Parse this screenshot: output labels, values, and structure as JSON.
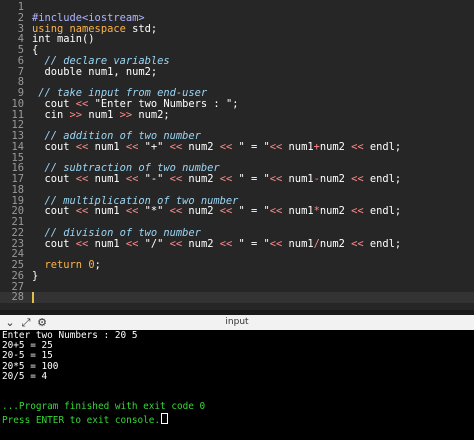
{
  "editor": {
    "lines": [
      {
        "n": "1",
        "tokens": []
      },
      {
        "n": "2",
        "tokens": [
          {
            "c": "pre",
            "t": "#include<iostream>"
          }
        ]
      },
      {
        "n": "3",
        "tokens": [
          {
            "c": "kw",
            "t": "using namespace"
          },
          {
            "c": "id",
            "t": " std;"
          }
        ]
      },
      {
        "n": "4",
        "tokens": [
          {
            "c": "id",
            "t": "int main()"
          }
        ]
      },
      {
        "n": "5",
        "tokens": [
          {
            "c": "id",
            "t": "{"
          }
        ]
      },
      {
        "n": "6",
        "tokens": [
          {
            "c": "com",
            "t": "  // declare variables"
          }
        ]
      },
      {
        "n": "7",
        "tokens": [
          {
            "c": "id",
            "t": "  double num1, num2;"
          }
        ]
      },
      {
        "n": "8",
        "tokens": []
      },
      {
        "n": "9",
        "tokens": [
          {
            "c": "com",
            "t": " // take input from end-user"
          }
        ]
      },
      {
        "n": "10",
        "tokens": [
          {
            "c": "id",
            "t": "  cout "
          },
          {
            "c": "op",
            "t": "<<"
          },
          {
            "c": "str",
            "t": " \"Enter two Numbers : \";"
          }
        ]
      },
      {
        "n": "11",
        "tokens": [
          {
            "c": "id",
            "t": "  cin "
          },
          {
            "c": "op",
            "t": ">>"
          },
          {
            "c": "id",
            "t": " num1 "
          },
          {
            "c": "op",
            "t": ">>"
          },
          {
            "c": "id",
            "t": " num2;"
          }
        ]
      },
      {
        "n": "12",
        "tokens": []
      },
      {
        "n": "13",
        "tokens": [
          {
            "c": "com",
            "t": "  // addition of two number"
          }
        ]
      },
      {
        "n": "14",
        "tokens": [
          {
            "c": "id",
            "t": "  cout "
          },
          {
            "c": "op",
            "t": "<<"
          },
          {
            "c": "id",
            "t": " num1 "
          },
          {
            "c": "op",
            "t": "<<"
          },
          {
            "c": "str",
            "t": " \"+\" "
          },
          {
            "c": "op",
            "t": "<<"
          },
          {
            "c": "id",
            "t": " num2 "
          },
          {
            "c": "op",
            "t": "<<"
          },
          {
            "c": "str",
            "t": " \" = \""
          },
          {
            "c": "op",
            "t": "<<"
          },
          {
            "c": "id",
            "t": " num1"
          },
          {
            "c": "op",
            "t": "+"
          },
          {
            "c": "id",
            "t": "num2 "
          },
          {
            "c": "op",
            "t": "<<"
          },
          {
            "c": "id",
            "t": " endl;"
          }
        ]
      },
      {
        "n": "15",
        "tokens": []
      },
      {
        "n": "16",
        "tokens": [
          {
            "c": "com",
            "t": "  // subtraction of two number"
          }
        ]
      },
      {
        "n": "17",
        "tokens": [
          {
            "c": "id",
            "t": "  cout "
          },
          {
            "c": "op",
            "t": "<<"
          },
          {
            "c": "id",
            "t": " num1 "
          },
          {
            "c": "op",
            "t": "<<"
          },
          {
            "c": "str",
            "t": " \"-\" "
          },
          {
            "c": "op",
            "t": "<<"
          },
          {
            "c": "id",
            "t": " num2 "
          },
          {
            "c": "op",
            "t": "<<"
          },
          {
            "c": "str",
            "t": " \" = \""
          },
          {
            "c": "op",
            "t": "<<"
          },
          {
            "c": "id",
            "t": " num1"
          },
          {
            "c": "op",
            "t": "-"
          },
          {
            "c": "id",
            "t": "num2 "
          },
          {
            "c": "op",
            "t": "<<"
          },
          {
            "c": "id",
            "t": " endl;"
          }
        ]
      },
      {
        "n": "18",
        "tokens": []
      },
      {
        "n": "19",
        "tokens": [
          {
            "c": "com",
            "t": "  // multiplication of two number"
          }
        ]
      },
      {
        "n": "20",
        "tokens": [
          {
            "c": "id",
            "t": "  cout "
          },
          {
            "c": "op",
            "t": "<<"
          },
          {
            "c": "id",
            "t": " num1 "
          },
          {
            "c": "op",
            "t": "<<"
          },
          {
            "c": "str",
            "t": " \"*\" "
          },
          {
            "c": "op",
            "t": "<<"
          },
          {
            "c": "id",
            "t": " num2 "
          },
          {
            "c": "op",
            "t": "<<"
          },
          {
            "c": "str",
            "t": " \" = \""
          },
          {
            "c": "op",
            "t": "<<"
          },
          {
            "c": "id",
            "t": " num1"
          },
          {
            "c": "op",
            "t": "*"
          },
          {
            "c": "id",
            "t": "num2 "
          },
          {
            "c": "op",
            "t": "<<"
          },
          {
            "c": "id",
            "t": " endl;"
          }
        ]
      },
      {
        "n": "21",
        "tokens": []
      },
      {
        "n": "22",
        "tokens": [
          {
            "c": "com",
            "t": "  // division of two number"
          }
        ]
      },
      {
        "n": "23",
        "tokens": [
          {
            "c": "id",
            "t": "  cout "
          },
          {
            "c": "op",
            "t": "<<"
          },
          {
            "c": "id",
            "t": " num1 "
          },
          {
            "c": "op",
            "t": "<<"
          },
          {
            "c": "str",
            "t": " \"/\" "
          },
          {
            "c": "op",
            "t": "<<"
          },
          {
            "c": "id",
            "t": " num2 "
          },
          {
            "c": "op",
            "t": "<<"
          },
          {
            "c": "str",
            "t": " \" = \""
          },
          {
            "c": "op",
            "t": "<<"
          },
          {
            "c": "id",
            "t": " num1"
          },
          {
            "c": "op",
            "t": "/"
          },
          {
            "c": "id",
            "t": "num2 "
          },
          {
            "c": "op",
            "t": "<<"
          },
          {
            "c": "id",
            "t": " endl;"
          }
        ]
      },
      {
        "n": "24",
        "tokens": []
      },
      {
        "n": "25",
        "tokens": [
          {
            "c": "id",
            "t": "  "
          },
          {
            "c": "kw",
            "t": "return"
          },
          {
            "c": "id",
            "t": " "
          },
          {
            "c": "num",
            "t": "0"
          },
          {
            "c": "id",
            "t": ";"
          }
        ]
      },
      {
        "n": "26",
        "tokens": [
          {
            "c": "id",
            "t": "}"
          }
        ]
      },
      {
        "n": "27",
        "tokens": []
      },
      {
        "n": "28",
        "tokens": []
      }
    ],
    "current_line": "28"
  },
  "panel": {
    "title": "input",
    "icons": [
      "chevron-down-icon",
      "expand-icon",
      "settings-icon"
    ]
  },
  "console": {
    "lines": [
      {
        "text": "Enter two Numbers : 20 5",
        "color": "white"
      },
      {
        "text": "20+5 = 25",
        "color": "white"
      },
      {
        "text": "20-5 = 15",
        "color": "white"
      },
      {
        "text": "20*5 = 100",
        "color": "white"
      },
      {
        "text": "20/5 = 4",
        "color": "white"
      },
      {
        "text": "",
        "color": "white"
      },
      {
        "text": "",
        "color": "white"
      },
      {
        "text": "...Program finished with exit code 0",
        "color": "green"
      },
      {
        "text": "Press ENTER to exit console.",
        "color": "green",
        "cursor": true
      }
    ]
  },
  "colors": {
    "editor_bg": "#262626",
    "console_bg": "#000000",
    "success_green": "#36d636",
    "keyword": "#ffb347",
    "comment": "#9bd6f5",
    "operator": "#ff8a8a"
  }
}
